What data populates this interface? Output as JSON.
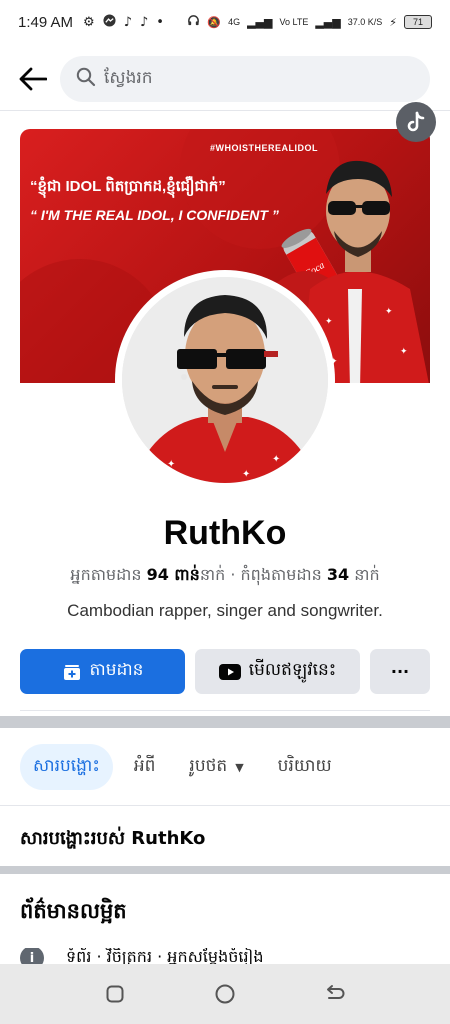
{
  "status_bar": {
    "time": "1:49 AM",
    "network_1": "4G",
    "network_2": "Vo LTE",
    "speed": "37.0 K/S",
    "battery": "71"
  },
  "search": {
    "placeholder": "ស្វែងរក"
  },
  "cover": {
    "hashtag": "#WHOISTHEREALIDOL",
    "line1": "“ខ្ញុំជា IDOL ពិតប្រាកដ,ខ្ញុំជឿជាក់”",
    "line2": "“ I'M THE REAL IDOL, I CONFIDENT ”",
    "can_text": "Coca",
    "bg_color": "#d91f1f"
  },
  "profile": {
    "name": "RuthKo",
    "followers_label": "អ្នកតាមដាន",
    "followers_value": "94 ពាន់",
    "followers_unit": "នាក់",
    "separator": "·",
    "following_label": "កំពុងតាមដាន",
    "following_value": "34",
    "following_unit": "នាក់",
    "bio": "Cambodian rapper, singer and songwriter."
  },
  "actions": {
    "follow_label": "តាមដាន",
    "watch_label": "មើលឥឡូវនេះ",
    "more_label": "···",
    "accent": "#1b6fe0"
  },
  "tabs": [
    {
      "label": "សារបង្ហោះ",
      "active": true
    },
    {
      "label": "អំពី",
      "active": false
    },
    {
      "label": "រូបថត",
      "active": false
    },
    {
      "label": "បរិយាយ",
      "active": false
    }
  ],
  "posts_title": "សារបង្ហោះរបស់ RuthKo",
  "info": {
    "title": "ព័ត៌មានលម្អិត",
    "row_text": "ទំព័រ · វិចិត្រករ · អ្នកសម្តែងចំរៀង",
    "row_icon": "i"
  }
}
